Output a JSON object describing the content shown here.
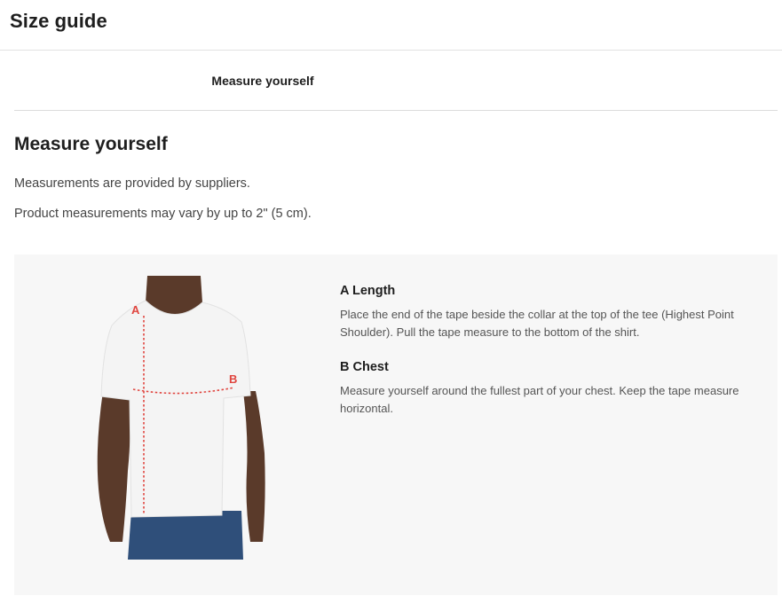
{
  "header": {
    "title": "Size guide"
  },
  "tabs": [
    {
      "label": "Measure yourself",
      "active": true
    }
  ],
  "section": {
    "title": "Measure yourself",
    "lines": [
      "Measurements are provided by suppliers.",
      "Product measurements may vary by up to 2\" (5 cm)."
    ]
  },
  "guide": {
    "figure": {
      "marker_a": "A",
      "marker_b": "B"
    },
    "measurements": [
      {
        "title": "A Length",
        "text": "Place the end of the tape beside the collar at the top of the tee (Highest Point Shoulder). Pull the tape measure to the bottom of the shirt."
      },
      {
        "title": "B Chest",
        "text": "Measure yourself around the fullest part of your chest. Keep the tape measure horizontal."
      }
    ]
  },
  "colors": {
    "panel_background": "#f7f7f7",
    "measure_marker": "#e0453f",
    "tshirt": "#f4f4f4",
    "skin": "#5a3a2a",
    "jeans": "#2f4f7a"
  }
}
